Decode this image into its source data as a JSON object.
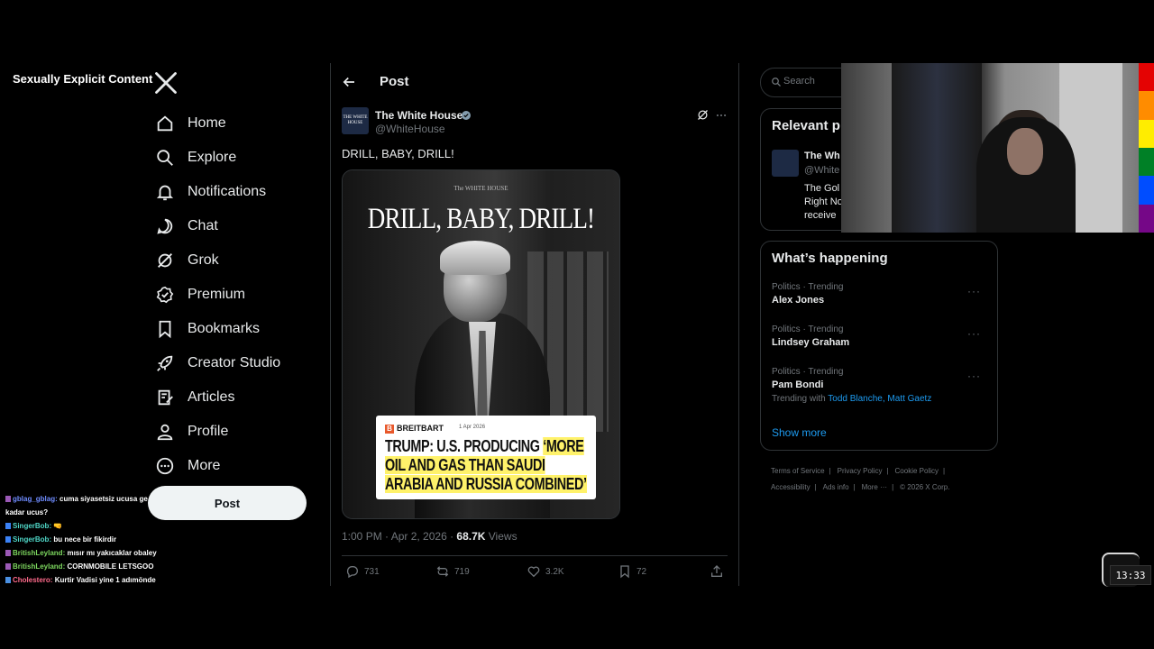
{
  "overlay_label": "Sexually Explicit Content",
  "nav": {
    "items": [
      {
        "label": "Home",
        "icon": "home-icon"
      },
      {
        "label": "Explore",
        "icon": "search-icon"
      },
      {
        "label": "Notifications",
        "icon": "bell-icon"
      },
      {
        "label": "Chat",
        "icon": "chat-icon"
      },
      {
        "label": "Grok",
        "icon": "grok-icon"
      },
      {
        "label": "Premium",
        "icon": "premium-icon"
      },
      {
        "label": "Bookmarks",
        "icon": "bookmark-icon"
      },
      {
        "label": "Creator Studio",
        "icon": "rocket-icon"
      },
      {
        "label": "Articles",
        "icon": "articles-icon"
      },
      {
        "label": "Profile",
        "icon": "person-icon"
      },
      {
        "label": "More",
        "icon": "more-circle-icon"
      }
    ],
    "post_button": "Post"
  },
  "chat": [
    {
      "user": "gblag_gblag:",
      "message": "cuma siyasetsiz ucusa ge",
      "user_color": "#6f8cff"
    },
    {
      "user": "",
      "message": "kadar ucus?",
      "user_color": "#ffffff"
    },
    {
      "user": "SingerBob:",
      "message": "",
      "user_color": "#4fd6c6"
    },
    {
      "user": "SingerBob:",
      "message": "bu nece bir fikirdir",
      "user_color": "#4fd6c6"
    },
    {
      "user": "BritishLeyland:",
      "message": "mısır mı yakıcaklar obaley",
      "user_color": "#7cd65e"
    },
    {
      "user": "BritishLeyland:",
      "message": "CORNMOBILE LETSGOO",
      "user_color": "#7cd65e"
    },
    {
      "user": "Cholestero:",
      "message": "Kurtir Vadisi yine 1 adımönde",
      "user_color": "#ff6a8b"
    }
  ],
  "header": {
    "title": "Post"
  },
  "tweet": {
    "author_name": "The White House",
    "author_handle": "@WhiteHouse",
    "avatar_text": "THE WHITE HOUSE",
    "text": "DRILL, BABY, DRILL!",
    "media": {
      "wh_logo": "The WHITE HOUSE",
      "headline": "DRILL, BABY, DRILL!",
      "card_brand": "BREITBART",
      "card_date": "1 Apr 2026",
      "card_headline_plain": "TRUMP: U.S. PRODUCING ",
      "card_headline_highlight": "‘MORE OIL AND GAS THAN SAUDI ARABIA AND RUSSIA COMBINED’"
    },
    "time": "1:00 PM · Apr 2, 2026 · ",
    "views": "68.7K",
    "views_label": " Views",
    "replies": "731",
    "reposts": "719",
    "likes": "3.2K",
    "bookmarks": "72"
  },
  "right": {
    "search_placeholder": "Search",
    "relevant_title": "Relevant p",
    "relevant_name": "The Wh",
    "relevant_handle": "@White",
    "relevant_bio": "The Gol Right No receive",
    "happening_title": "What’s happening",
    "trends": [
      {
        "category": "Politics · Trending",
        "name": "Alex Jones"
      },
      {
        "category": "Politics · Trending",
        "name": "Lindsey Graham"
      },
      {
        "category": "Politics · Trending",
        "name": "Pam Bondi",
        "with_label": "Trending with ",
        "with_links": "Todd Blanche, Matt Gaetz"
      }
    ],
    "show_more": "Show more",
    "footer": [
      "Terms of Service",
      "Privacy Policy",
      "Cookie Policy",
      "Accessibility",
      "Ads info",
      "More ···",
      "© 2026 X Corp."
    ]
  },
  "clock": "13:33",
  "colors": {
    "background": "#000000",
    "text": "#e7e9ea",
    "muted": "#71767b",
    "accent": "#1d9bf0",
    "border": "#2f3336",
    "highlight": "#fff26a",
    "rainbow": [
      "#e40303",
      "#ff8c00",
      "#ffed00",
      "#008026",
      "#004dff",
      "#750787"
    ]
  }
}
